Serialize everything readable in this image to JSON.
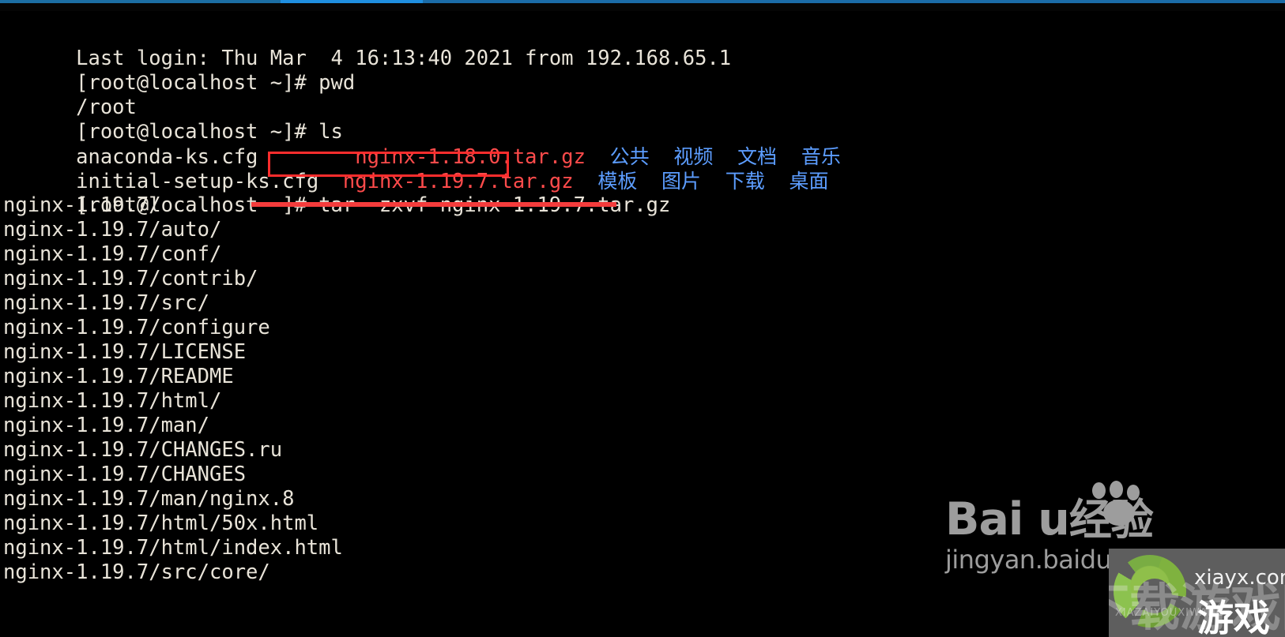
{
  "window": {
    "accent_color": "#1f8fe0",
    "bar_color": "#1b6ca8"
  },
  "terminal": {
    "background": "#000000",
    "foreground": "#e9e4d9",
    "archive_color": "#ff4b4b",
    "directory_color": "#5c9dff",
    "prompt": "[root@localhost ~]#",
    "lines": [
      {
        "id": "l1",
        "kind": "output",
        "text": "Last login: Thu Mar  4 16:13:40 2021 from 192.168.65.1"
      },
      {
        "id": "l2",
        "kind": "command",
        "prompt": "[root@localhost ~]# ",
        "command": "pwd"
      },
      {
        "id": "l3",
        "kind": "output",
        "text": "/root"
      },
      {
        "id": "l4",
        "kind": "command",
        "prompt": "[root@localhost ~]# ",
        "command": "ls"
      },
      {
        "id": "l5",
        "kind": "ls-row-1"
      },
      {
        "id": "l6",
        "kind": "ls-row-2"
      },
      {
        "id": "l7",
        "kind": "command",
        "prompt": "[root@localhost ~]# ",
        "command": "tar -zxvf nginx-1.19.7.tar.gz"
      },
      {
        "id": "l8",
        "kind": "output",
        "text": "nginx-1.19.7/"
      },
      {
        "id": "l9",
        "kind": "output",
        "text": "nginx-1.19.7/auto/"
      },
      {
        "id": "l10",
        "kind": "output",
        "text": "nginx-1.19.7/conf/"
      },
      {
        "id": "l11",
        "kind": "output",
        "text": "nginx-1.19.7/contrib/"
      },
      {
        "id": "l12",
        "kind": "output",
        "text": "nginx-1.19.7/src/"
      },
      {
        "id": "l13",
        "kind": "output",
        "text": "nginx-1.19.7/configure"
      },
      {
        "id": "l14",
        "kind": "output",
        "text": "nginx-1.19.7/LICENSE"
      },
      {
        "id": "l15",
        "kind": "output",
        "text": "nginx-1.19.7/README"
      },
      {
        "id": "l16",
        "kind": "output",
        "text": "nginx-1.19.7/html/"
      },
      {
        "id": "l17",
        "kind": "output",
        "text": "nginx-1.19.7/man/"
      },
      {
        "id": "l18",
        "kind": "output",
        "text": "nginx-1.19.7/CHANGES.ru"
      },
      {
        "id": "l19",
        "kind": "output",
        "text": "nginx-1.19.7/CHANGES"
      },
      {
        "id": "l20",
        "kind": "output",
        "text": "nginx-1.19.7/man/nginx.8"
      },
      {
        "id": "l21",
        "kind": "output",
        "text": "nginx-1.19.7/html/50x.html"
      },
      {
        "id": "l22",
        "kind": "output",
        "text": "nginx-1.19.7/html/index.html"
      },
      {
        "id": "l23",
        "kind": "output",
        "text": "nginx-1.19.7/src/core/"
      }
    ],
    "listing": {
      "row1": {
        "file": "anaconda-ks.cfg",
        "archive": "nginx-1.18.0.tar.gz",
        "dirs": [
          "公共",
          "视频",
          "文档",
          "音乐"
        ]
      },
      "row2": {
        "file": "initial-setup-ks.cfg",
        "archive": "nginx-1.19.7.tar.gz",
        "dirs": [
          "模板",
          "图片",
          "下载",
          "桌面"
        ]
      }
    }
  },
  "annotations": {
    "highlight_box_target": "nginx-1.19.7.tar.gz",
    "underline_target": "tar -zxvf nginx-1.19.7.tar.gz",
    "color": "#ff2d2d"
  },
  "watermarks": {
    "baidu": {
      "brand": "Bai  u",
      "brand_cn": "经验",
      "url": "jingyan.baidu.com"
    },
    "game": {
      "site": "xiayx.com",
      "label": "游戏",
      "ghost_label": "下载游戏网",
      "ghost_pinyin": "XIAZAIYOUXIWANG"
    }
  }
}
